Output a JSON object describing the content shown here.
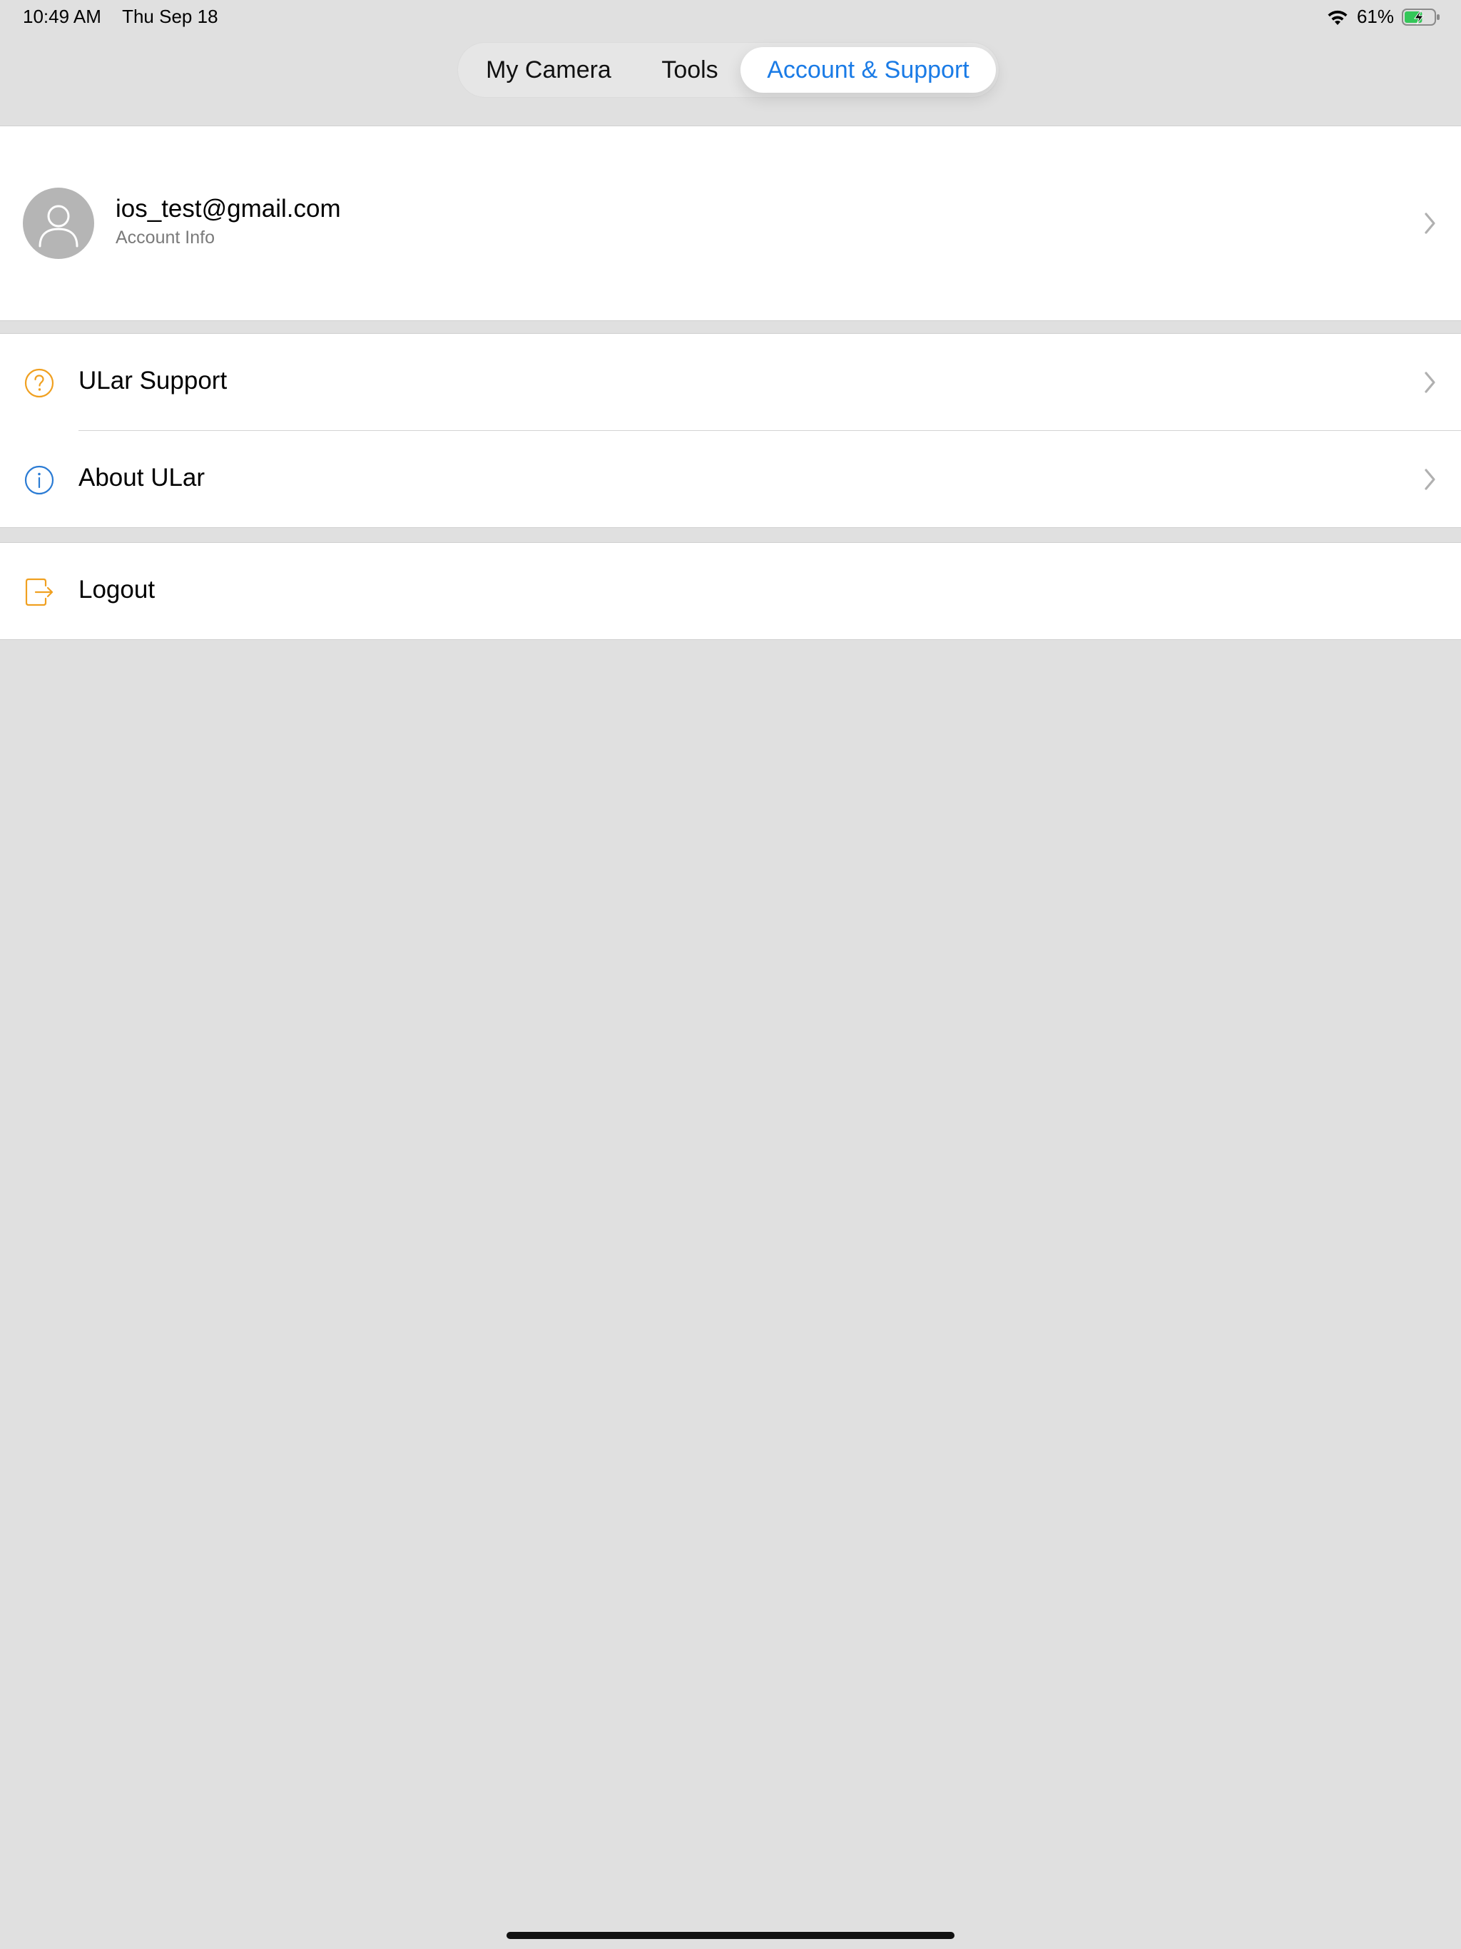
{
  "status_bar": {
    "time": "10:49 AM",
    "date": "Thu Sep 18",
    "battery_percent": "61%",
    "battery_level": 0.61,
    "charging": true,
    "icons": [
      "wifi-icon",
      "battery-charging-icon"
    ]
  },
  "tabs": [
    {
      "label": "My Camera",
      "selected": false
    },
    {
      "label": "Tools",
      "selected": false
    },
    {
      "label": "Account & Support",
      "selected": true
    }
  ],
  "account": {
    "email": "ios_test@gmail.com",
    "subtitle": "Account Info",
    "icons": [
      "avatar-person-icon",
      "chevron-right-icon"
    ]
  },
  "menu": {
    "support_label": "ULar Support",
    "about_label": "About ULar",
    "logout_label": "Logout",
    "icons": [
      "question-circle-icon",
      "info-circle-icon",
      "logout-icon",
      "chevron-right-icon"
    ]
  },
  "colors": {
    "accent": "#1a7be6",
    "support_icon": "#f0a020",
    "about_icon": "#2a7bd4",
    "logout_icon": "#f0a020",
    "background": "#e0e0e0",
    "battery_fill": "#34c759"
  }
}
